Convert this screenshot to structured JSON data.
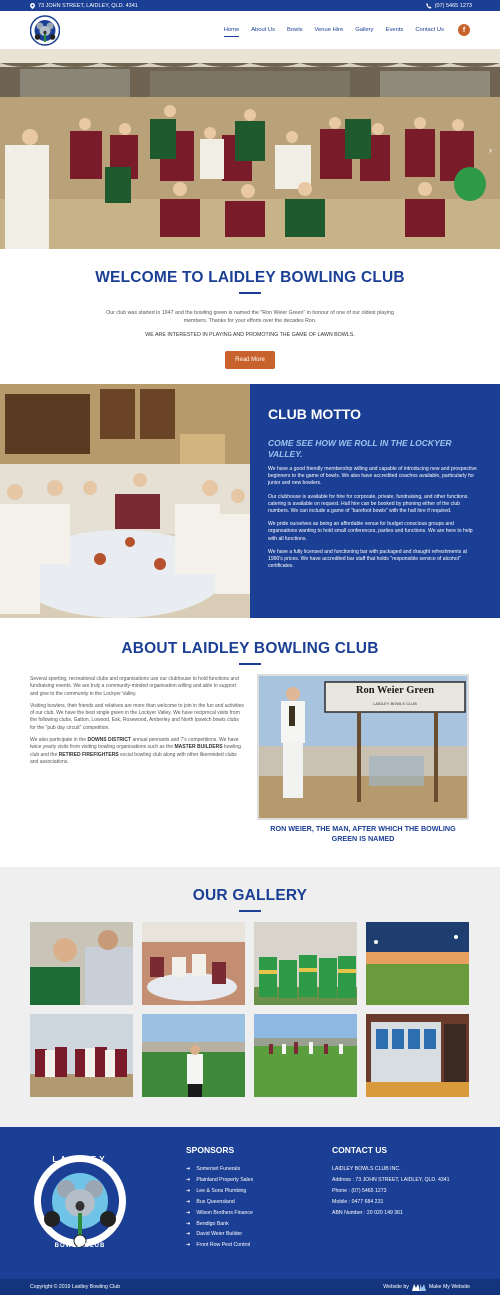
{
  "topbar": {
    "address": "73 JOHN STREET, LAIDLEY, QLD. 4341",
    "phone": "(07) 5465 1273"
  },
  "nav": {
    "items": [
      "Home",
      "About Us",
      "Bowls",
      "Venue Hire",
      "Gallery",
      "Events",
      "Contact Us"
    ],
    "facebook": "f"
  },
  "logo": {
    "text_top": "LAIDLEY",
    "text_bottom": "BOWLS CLUB"
  },
  "welcome": {
    "title": "WELCOME TO LAIDLEY BOWLING CLUB",
    "intro": "Our club was started in 1947 and the bowling green is named the \"Ron Weier Green\" in honour of one of our oldest playing members. Thanks for your efforts over the decades Ron.",
    "interest": "WE ARE INTERESTED IN PLAYING AND PROMOTING THE GAME OF LAWN BOWLS.",
    "button": "Read More"
  },
  "motto": {
    "title": "CLUB MOTTO",
    "tagline": "COME SEE HOW WE ROLL IN THE LOCKYER VALLEY.",
    "paragraphs": [
      "We have a good friendly membership willing and capable of introducing new and prospective beginners to the game of bowls. We also have accredited coaches available, particularly for junior and new bowlers.",
      "Our clubhouse is available for hire for corporate, private, fundraising, and other functions. catering is available on request. Hall hire can be booked by phoning either of the club numbers. We can include a game of \"barefoot bowls\" with the hall hire if required.",
      "We pride ourselves as being an affordable venue for budget conscious groups and organsations wanting to hold small conferences, parties and functions. We are here to help with all functions.",
      "We have a fully licensed and functioning bar with packaged and draught refreshments at 1990's prices. We have accredited bar staff that holds \"responsible service of alcohol\" certificates."
    ]
  },
  "about": {
    "title": "ABOUT LAIDLEY BOWLING CLUB",
    "p1": "Several sporting, recreational clubs and organisations use our clubhouse to hold functions and fundraising events. We are truly a community-minded organisation willing and able to support and give to the community in the Lockyer Valley.",
    "p2": "Visiting bowlers, their friends and relatives are more than welcome to join in the fun and activities of our club. We have the best single green in the Lockyer Valley. We have reciprocal visits from the following clubs, Gatton, Lowood, Esk, Rosewood, Amberley and North Ipswich bowls clubs for the \"pub day circuit\" competition.",
    "p3_a": "We also participate in the ",
    "p3_b": "DOWNS DISTRICT",
    "p3_c": " annual pennants and 7's competitions. We have twice yearly visits from visiting bowling organisations such as the ",
    "p3_d": "MASTER BUILDERS",
    "p3_e": " bowling club and the ",
    "p3_f": "RETIRED FIREFIGHTERS",
    "p3_g": " social bowling club along with other likeminded clubs and associations.",
    "sign_main": "Ron Weier Green",
    "sign_sub": "LAIDLEY BOWLS CLUB",
    "caption": "RON WEIER, THE MAN, AFTER WHICH THE BOWLING GREEN IS NAMED"
  },
  "gallery": {
    "title": "OUR GALLERY"
  },
  "footer": {
    "sponsors_title": "SPONSORS",
    "sponsors": [
      "Somerset Funerals",
      "Plainland Property Sales",
      "Lee & Sons Plumbing",
      "Bus Queensland",
      "Wilson Brothers Finance",
      "Bendigo Bank",
      "David Weier Builder",
      "Front Row Pest Control"
    ],
    "contact_title": "CONTACT US",
    "contact": {
      "name": "LAIDLEY BOWLS CLUB INC.",
      "address": "Address : 73 JOHN STREET, LAIDLEY, QLD. 4341",
      "phone": "Phone : (07) 5465 1273",
      "mobile": "Mobile : 0477 684 231",
      "abn": "ABN Number : 20 020 149 361"
    },
    "copyright": "Copyright © 2019 Laidley Bowling Club",
    "website_by": "Website by",
    "brand": "Make My Website"
  },
  "colors": {
    "primary": "#1b3f94",
    "accent": "#c8622c",
    "gallery_bg": "#efefef"
  }
}
